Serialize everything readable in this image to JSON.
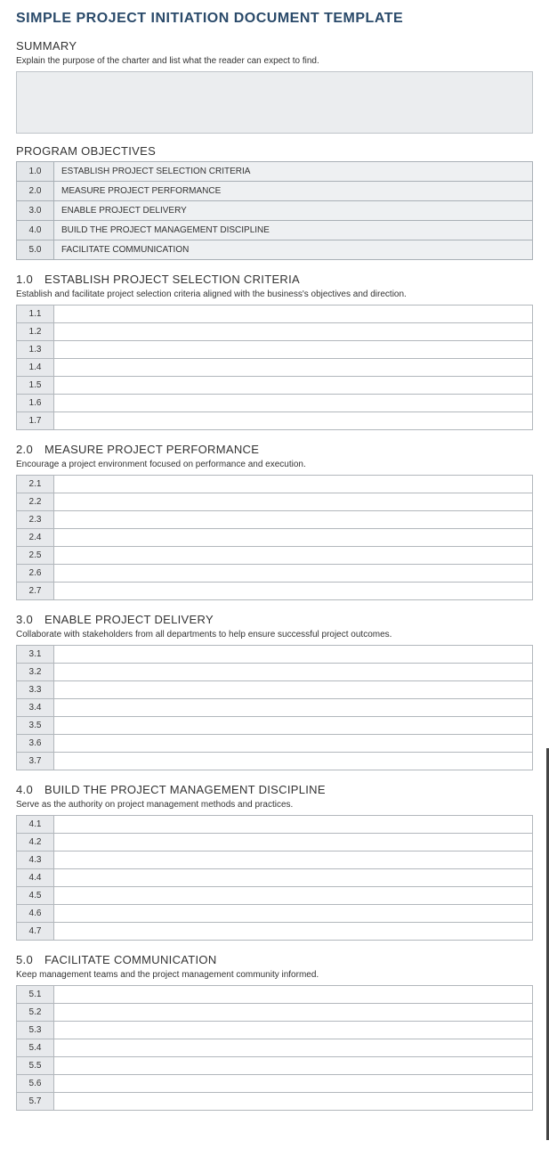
{
  "title": "SIMPLE PROJECT INITIATION DOCUMENT TEMPLATE",
  "summary": {
    "heading": "SUMMARY",
    "desc": "Explain the purpose of the charter and list what the reader can expect to find."
  },
  "objectives": {
    "heading": "PROGRAM OBJECTIVES",
    "rows": [
      {
        "num": "1.0",
        "label": "ESTABLISH PROJECT SELECTION CRITERIA"
      },
      {
        "num": "2.0",
        "label": "MEASURE PROJECT PERFORMANCE"
      },
      {
        "num": "3.0",
        "label": "ENABLE PROJECT DELIVERY"
      },
      {
        "num": "4.0",
        "label": "BUILD THE PROJECT MANAGEMENT DISCIPLINE"
      },
      {
        "num": "5.0",
        "label": "FACILITATE COMMUNICATION"
      }
    ]
  },
  "sections": [
    {
      "num": "1.0",
      "title": "ESTABLISH PROJECT SELECTION CRITERIA",
      "desc": "Establish and facilitate project selection criteria aligned with the business's objectives and direction.",
      "rows": [
        "1.1",
        "1.2",
        "1.3",
        "1.4",
        "1.5",
        "1.6",
        "1.7"
      ]
    },
    {
      "num": "2.0",
      "title": "MEASURE PROJECT PERFORMANCE",
      "desc": "Encourage a project environment focused on performance and execution.",
      "rows": [
        "2.1",
        "2.2",
        "2.3",
        "2.4",
        "2.5",
        "2.6",
        "2.7"
      ]
    },
    {
      "num": "3.0",
      "title": "ENABLE PROJECT DELIVERY",
      "desc": "Collaborate with stakeholders from all departments to help ensure successful project outcomes.",
      "rows": [
        "3.1",
        "3.2",
        "3.3",
        "3.4",
        "3.5",
        "3.6",
        "3.7"
      ]
    },
    {
      "num": "4.0",
      "title": "BUILD THE PROJECT MANAGEMENT DISCIPLINE",
      "desc": "Serve as the authority on project management methods and practices.",
      "rows": [
        "4.1",
        "4.2",
        "4.3",
        "4.4",
        "4.5",
        "4.6",
        "4.7"
      ]
    },
    {
      "num": "5.0",
      "title": "FACILITATE COMMUNICATION",
      "desc": "Keep management teams and the project management community informed.",
      "rows": [
        "5.1",
        "5.2",
        "5.3",
        "5.4",
        "5.5",
        "5.6",
        "5.7"
      ]
    }
  ]
}
